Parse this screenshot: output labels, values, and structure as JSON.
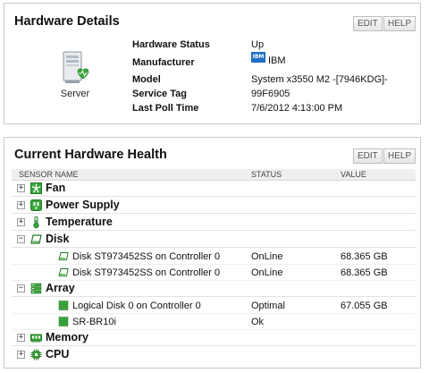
{
  "details": {
    "title": "Hardware Details",
    "edit_label": "EDIT",
    "help_label": "HELP",
    "server_label": "Server",
    "fields": [
      {
        "label": "Hardware Status",
        "value": "Up"
      },
      {
        "label": "Manufacturer",
        "value": "IBM"
      },
      {
        "label": "Model",
        "value": "System x3550 M2 -[7946KDG]-"
      },
      {
        "label": "Service Tag",
        "value": "99F6905"
      },
      {
        "label": "Last Poll Time",
        "value": "7/6/2012 4:13:00 PM"
      }
    ],
    "ibm_logo_text": "IBM"
  },
  "health": {
    "title": "Current Hardware Health",
    "edit_label": "EDIT",
    "help_label": "HELP",
    "columns": {
      "sensor": "SENSOR NAME",
      "status": "STATUS",
      "value": "VALUE"
    },
    "categories": [
      {
        "label": "Fan",
        "expanded": false,
        "toggle": "+",
        "icon": "fan-icon"
      },
      {
        "label": "Power Supply",
        "expanded": false,
        "toggle": "+",
        "icon": "power-supply-icon"
      },
      {
        "label": "Temperature",
        "expanded": false,
        "toggle": "+",
        "icon": "thermometer-icon"
      },
      {
        "label": "Disk",
        "expanded": true,
        "toggle": "−",
        "icon": "disk-icon",
        "items": [
          {
            "name": "Disk ST973452SS on Controller 0",
            "status": "OnLine",
            "value": "68.365 GB"
          },
          {
            "name": "Disk ST973452SS on Controller 0",
            "status": "OnLine",
            "value": "68.365 GB"
          }
        ]
      },
      {
        "label": "Array",
        "expanded": true,
        "toggle": "−",
        "icon": "array-icon",
        "items": [
          {
            "name": "Logical Disk 0 on Controller 0",
            "status": "Optimal",
            "value": "67.055 GB"
          },
          {
            "name": "SR-BR10i",
            "status": "Ok",
            "value": ""
          }
        ]
      },
      {
        "label": "Memory",
        "expanded": false,
        "toggle": "+",
        "icon": "memory-icon"
      },
      {
        "label": "CPU",
        "expanded": false,
        "toggle": "+",
        "icon": "cpu-icon"
      }
    ]
  },
  "colors": {
    "status_green": "#3aa63a",
    "ibm_blue": "#1f70c1"
  }
}
